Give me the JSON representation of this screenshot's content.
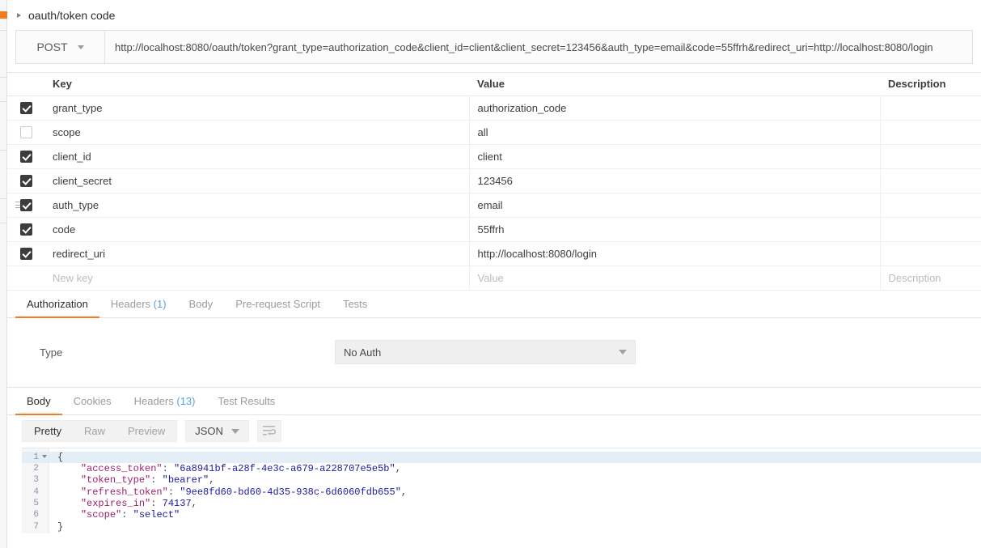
{
  "request": {
    "title": "oauth/token code",
    "method": "POST",
    "url": "http://localhost:8080/oauth/token?grant_type=authorization_code&client_id=client&client_secret=123456&auth_type=email&code=55ffrh&redirect_uri=http://localhost:8080/login"
  },
  "params": {
    "headers": {
      "key": "Key",
      "value": "Value",
      "description": "Description"
    },
    "rows": [
      {
        "checked": true,
        "key": "grant_type",
        "value": "authorization_code",
        "description": ""
      },
      {
        "checked": false,
        "key": "scope",
        "value": "all",
        "description": ""
      },
      {
        "checked": true,
        "key": "client_id",
        "value": "client",
        "description": ""
      },
      {
        "checked": true,
        "key": "client_secret",
        "value": "123456",
        "description": ""
      },
      {
        "checked": true,
        "key": "auth_type",
        "value": "email",
        "description": ""
      },
      {
        "checked": true,
        "key": "code",
        "value": "55ffrh",
        "description": ""
      },
      {
        "checked": true,
        "key": "redirect_uri",
        "value": "http://localhost:8080/login",
        "description": ""
      }
    ],
    "new_row": {
      "key": "New key",
      "value": "Value",
      "description": "Description"
    }
  },
  "request_tabs": [
    {
      "label": "Authorization",
      "count": "",
      "active": true
    },
    {
      "label": "Headers",
      "count": "(1)",
      "active": false
    },
    {
      "label": "Body",
      "count": "",
      "active": false
    },
    {
      "label": "Pre-request Script",
      "count": "",
      "active": false
    },
    {
      "label": "Tests",
      "count": "",
      "active": false
    }
  ],
  "authorization": {
    "type_label": "Type",
    "type_value": "No Auth"
  },
  "response_tabs": [
    {
      "label": "Body",
      "count": "",
      "active": true
    },
    {
      "label": "Cookies",
      "count": "",
      "active": false
    },
    {
      "label": "Headers",
      "count": "(13)",
      "active": false
    },
    {
      "label": "Test Results",
      "count": "",
      "active": false
    }
  ],
  "response_toolbar": {
    "view_modes": [
      {
        "label": "Pretty",
        "active": true
      },
      {
        "label": "Raw",
        "active": false
      },
      {
        "label": "Preview",
        "active": false
      }
    ],
    "format": "JSON",
    "wrap_icon": "word-wrap-icon"
  },
  "response_body": {
    "line_numbers": [
      "1",
      "2",
      "3",
      "4",
      "5",
      "6",
      "7"
    ],
    "json": {
      "access_token": "6a8941bf-a28f-4e3c-a679-a228707e5e5b",
      "token_type": "bearer",
      "refresh_token": "9ee8fd60-bd60-4d35-938c-6d6060fdb655",
      "expires_in": "74137",
      "scope": "select"
    },
    "lines": [
      "{",
      "    \"access_token\": \"6a8941bf-a28f-4e3c-a679-a228707e5e5b\",",
      "    \"token_type\": \"bearer\",",
      "    \"refresh_token\": \"9ee8fd60-bd60-4d35-938c-6d6060fdb655\",",
      "    \"expires_in\": 74137,",
      "    \"scope\": \"select\"",
      "}"
    ]
  },
  "colors": {
    "accent": "#f37b21",
    "link": "#5aa0dd",
    "json_key": "#a11f6e",
    "json_string": "#1a1aa6",
    "highlight_line": "#e4eef7"
  }
}
